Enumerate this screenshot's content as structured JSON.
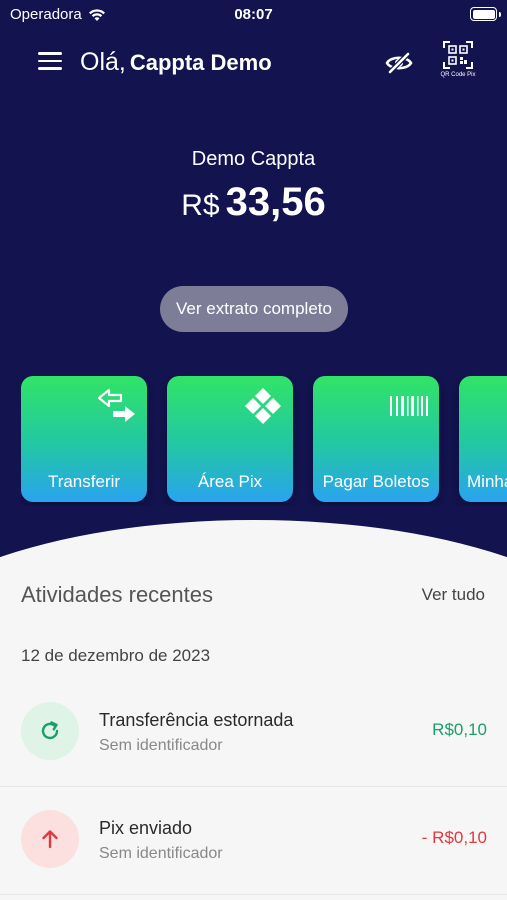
{
  "status": {
    "carrier": "Operadora",
    "time": "08:07"
  },
  "header": {
    "greeting": "Olá,",
    "user_name": "Cappta Demo",
    "qr_label": "QR Code Pix"
  },
  "account": {
    "name": "Demo Cappta",
    "currency": "R$",
    "balance": "33,56",
    "statement_button": "Ver extrato completo"
  },
  "actions": [
    {
      "label": "Transferir",
      "icon": "transfer-icon"
    },
    {
      "label": "Área Pix",
      "icon": "pix-icon"
    },
    {
      "label": "Pagar Boletos",
      "icon": "barcode-icon"
    },
    {
      "label": "Minha",
      "icon": "unknown"
    }
  ],
  "recent": {
    "title": "Atividades recentes",
    "see_all": "Ver tudo",
    "date": "12 de dezembro de 2023",
    "transactions": [
      {
        "title": "Transferência estornada",
        "subtitle": "Sem identificador",
        "amount": "R$0,10",
        "type": "refund"
      },
      {
        "title": "Pix enviado",
        "subtitle": "Sem identificador",
        "amount": "- R$0,10",
        "type": "sent"
      }
    ]
  },
  "colors": {
    "header_bg": "#12134f",
    "positive": "#1a9e6a",
    "negative": "#e0393e",
    "refund_icon_bg": "#dff3e6",
    "sent_icon_bg": "#fbe0df"
  }
}
